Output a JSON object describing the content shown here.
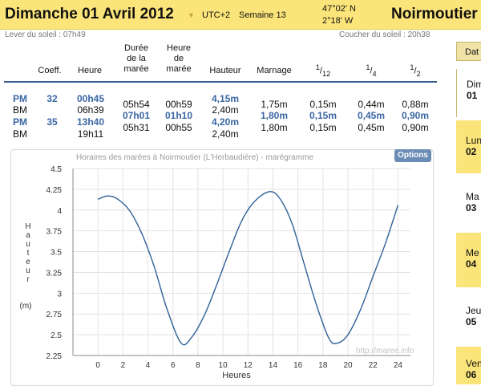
{
  "header": {
    "date": "Dimanche 01 Avril 2012",
    "timezone": "UTC+2",
    "week": "Semaine 13",
    "lat": "47°02' N",
    "lon": "2°18' W",
    "city": "Noirmoutier"
  },
  "sun": {
    "rise": "Lever du soleil : 07h49",
    "set": "Coucher du soleil : 20h38"
  },
  "table": {
    "headers": {
      "coeff": "Coeff.",
      "heure": "Heure",
      "duree": [
        "Durée",
        "de la",
        "marée"
      ],
      "heure_maree": [
        "Heure",
        "de",
        "marée"
      ],
      "hauteur": "Hauteur",
      "marnage": "Marnage",
      "frac12": {
        "num": "1",
        "den": "12"
      },
      "frac4": {
        "num": "1",
        "den": "4"
      },
      "frac2": {
        "num": "1",
        "den": "2"
      }
    },
    "rows": [
      {
        "type": "PM",
        "coeff": "32",
        "heure": "00h45",
        "hauteur": "4,15m",
        "blue": true
      },
      {
        "type": "BM",
        "coeff": "",
        "heure": "06h39",
        "hauteur": "2,40m",
        "blue": false
      },
      {
        "type": "PM",
        "coeff": "35",
        "heure": "13h40",
        "hauteur": "4,20m",
        "blue": true
      },
      {
        "type": "BM",
        "coeff": "",
        "heure": "19h11",
        "hauteur": "2,40m",
        "blue": false
      }
    ],
    "between": [
      {
        "duree": "05h54",
        "heure_maree": "00h59",
        "marnage": "1,75m",
        "f12": "0,15m",
        "f4": "0,44m",
        "f2": "0,88m",
        "blue": false
      },
      {
        "duree": "07h01",
        "heure_maree": "01h10",
        "marnage": "1,80m",
        "f12": "0,15m",
        "f4": "0,45m",
        "f2": "0,90m",
        "blue": true
      },
      {
        "duree": "05h31",
        "heure_maree": "00h55",
        "marnage": "1,80m",
        "f12": "0,15m",
        "f4": "0,45m",
        "f2": "0,90m",
        "blue": false
      }
    ]
  },
  "sidebar": {
    "tab_label": "Dat",
    "items": [
      {
        "day": "Dim",
        "num": "01",
        "selected": true
      },
      {
        "day": "Lun",
        "num": "02",
        "selected": false
      },
      {
        "day": "Ma",
        "num": "03",
        "selected": false
      },
      {
        "day": "Me",
        "num": "04",
        "selected": false
      },
      {
        "day": "Jeu",
        "num": "05",
        "selected": false
      },
      {
        "day": "Ven",
        "num": "06",
        "selected": false
      }
    ]
  },
  "chart": {
    "title": "Horaires des marées à Noirmoutier (L'Herbaudière) - marégramme",
    "options_label": "Options",
    "watermark": "http://maree.info"
  },
  "chart_data": {
    "type": "line",
    "xlabel": "Heures",
    "ylabel": "Hauteur (m)",
    "ylabel_letters": [
      "H",
      "a",
      "u",
      "t",
      "e",
      "u",
      "r"
    ],
    "ylabel_unit": "(m)",
    "xlim": [
      -2,
      25
    ],
    "ylim": [
      2.25,
      4.5
    ],
    "xticks": [
      0,
      2,
      4,
      6,
      8,
      10,
      12,
      14,
      16,
      18,
      20,
      22,
      24
    ],
    "yticks": [
      2.25,
      2.5,
      2.75,
      3,
      3.25,
      3.5,
      3.75,
      4,
      4.25,
      4.5
    ],
    "ytick_labels": [
      "2.25",
      "2.5",
      "2.75",
      "3",
      "3.25",
      "3.5",
      "3.75",
      "4",
      "4.25",
      "4.5"
    ],
    "series": [
      {
        "name": "",
        "x": [
          0,
          0.75,
          1.5,
          2.5,
          3.5,
          4.5,
          5.5,
          6.65,
          7.5,
          8.5,
          9.5,
          10.5,
          11.5,
          12.5,
          13.67,
          14.5,
          15.5,
          16.5,
          17.5,
          18.5,
          19.18,
          20,
          21,
          22,
          23,
          24
        ],
        "y": [
          4.13,
          4.17,
          4.14,
          4.0,
          3.72,
          3.32,
          2.82,
          2.4,
          2.47,
          2.73,
          3.1,
          3.5,
          3.87,
          4.1,
          4.22,
          4.15,
          3.85,
          3.35,
          2.85,
          2.45,
          2.4,
          2.5,
          2.8,
          3.2,
          3.6,
          4.06
        ],
        "color": "#2f6098"
      }
    ]
  }
}
